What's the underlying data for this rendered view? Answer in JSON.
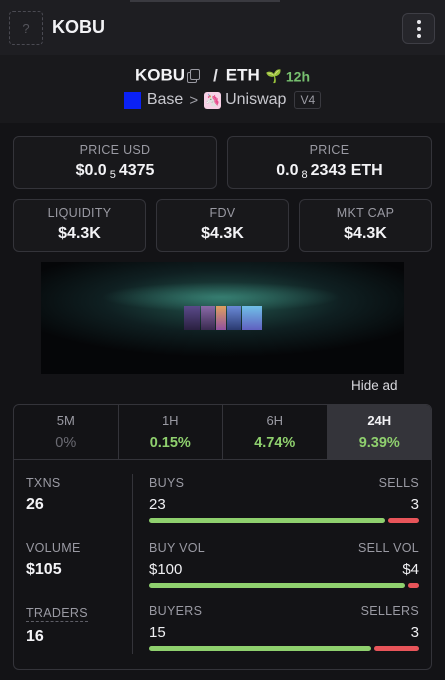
{
  "header": {
    "logo_placeholder": "?",
    "token": "KOBU"
  },
  "pair": {
    "base": "KOBU",
    "quote": "ETH",
    "age": "12h",
    "chain": "Base",
    "dex": "Uniswap",
    "version": "V4"
  },
  "prices": {
    "usd": {
      "label": "PRICE USD",
      "prefix": "$0.0",
      "zeros": "5",
      "digits": "4375"
    },
    "native": {
      "label": "PRICE",
      "prefix": "0.0",
      "zeros": "8",
      "digits": "2343 ETH"
    }
  },
  "metrics": [
    {
      "label": "LIQUIDITY",
      "value": "$4.3K"
    },
    {
      "label": "FDV",
      "value": "$4.3K"
    },
    {
      "label": "MKT CAP",
      "value": "$4.3K"
    }
  ],
  "ad": {
    "hide_label": "Hide ad"
  },
  "tabs": [
    {
      "label": "5M",
      "value": "0%"
    },
    {
      "label": "1H",
      "value": "0.15%"
    },
    {
      "label": "6H",
      "value": "4.74%"
    },
    {
      "label": "24H",
      "value": "9.39%"
    }
  ],
  "stats": {
    "txns": {
      "label": "TXNS",
      "value": "26",
      "left_label": "BUYS",
      "left_value": "23",
      "right_label": "SELLS",
      "right_value": "3",
      "ratio": 0.885
    },
    "volume": {
      "label": "VOLUME",
      "value": "$105",
      "left_label": "BUY VOL",
      "left_value": "$100",
      "right_label": "SELL VOL",
      "right_value": "$4",
      "ratio": 0.96
    },
    "traders": {
      "label": "TRADERS",
      "value": "16",
      "left_label": "BUYERS",
      "left_value": "15",
      "right_label": "SELLERS",
      "right_value": "3",
      "ratio": 0.833
    }
  },
  "colors": {
    "positive": "#8fd06e",
    "negative": "#e8555a",
    "base_chain": "#0a21f5"
  }
}
